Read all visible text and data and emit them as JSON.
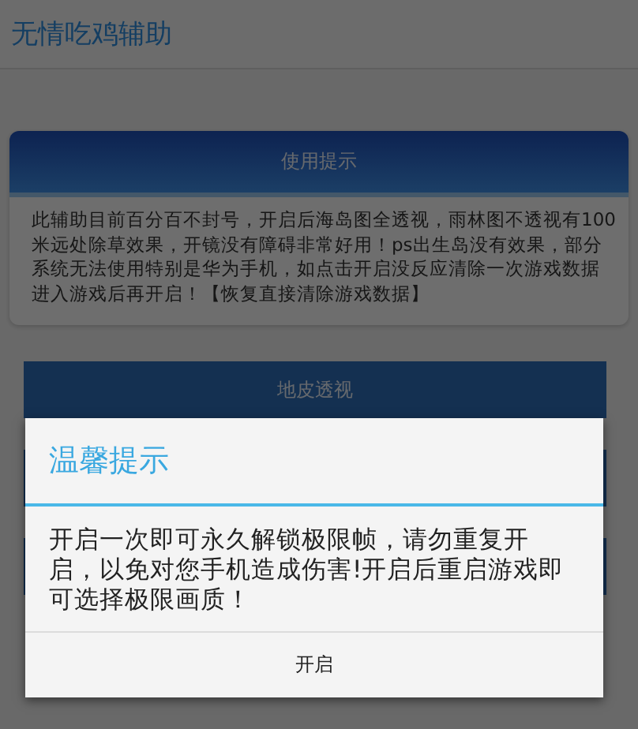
{
  "app_bar": {
    "title": "无情吃鸡辅助"
  },
  "notice_card": {
    "title": "使用提示",
    "text": "此辅助目前百分百不封号，开启后海岛图全透视，雨林图不透视有100米远处除草效果，开镜没有障碍非常好用！ps出生岛没有效果，部分系统无法使用特别是华为手机，如点击开启没反应清除一次游戏数据进入游戏后再开启！【恢复直接清除游戏数据】"
  },
  "buttons": [
    {
      "label": "地皮透视"
    }
  ],
  "dialog": {
    "title": "温馨提示",
    "message": "开启一次即可永久解锁极限帧，请勿重复开启，以免对您手机造成伤害!开启后重启游戏即可选择极限画质！",
    "button": "开启"
  }
}
